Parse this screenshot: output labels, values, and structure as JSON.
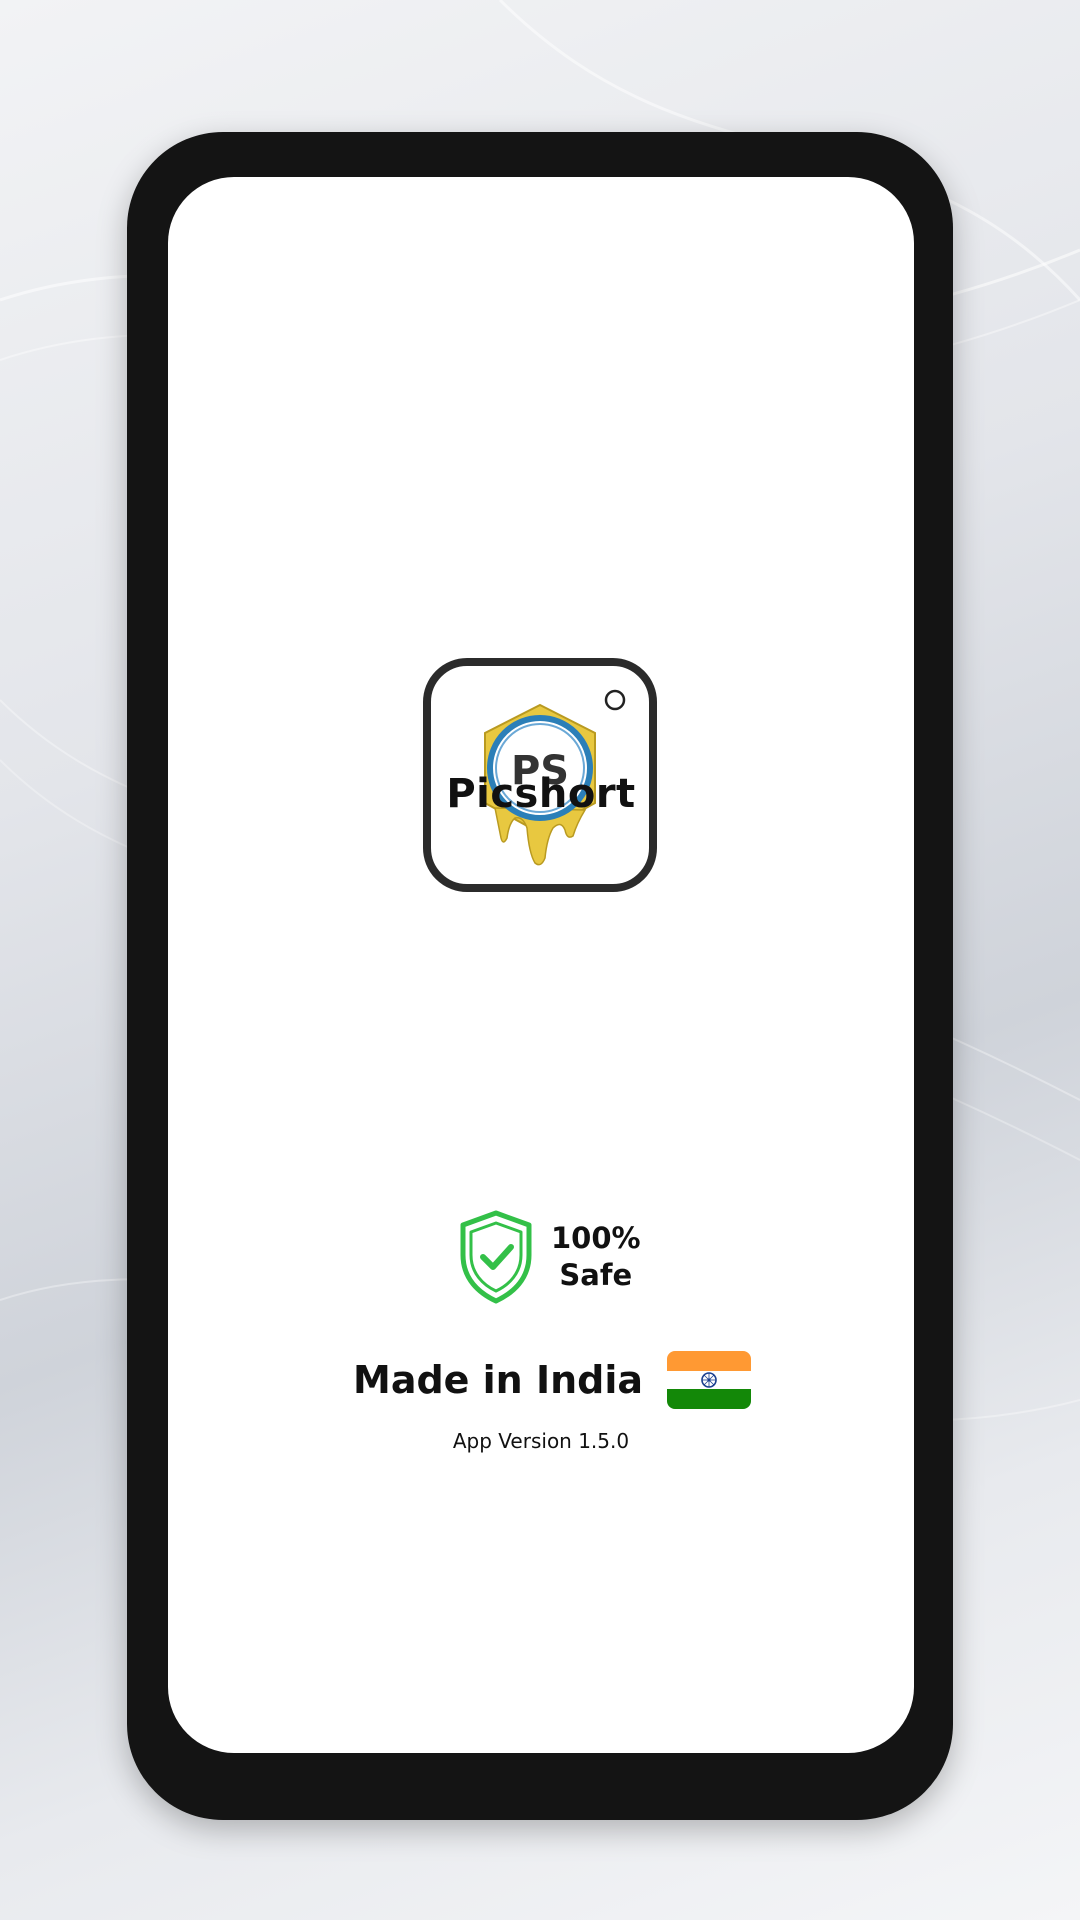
{
  "app": {
    "name": "Picshort",
    "logo_text": "PS"
  },
  "badge": {
    "percent": "100%",
    "label": "Safe"
  },
  "footer": {
    "made_in": "Made in India",
    "version": "App Version 1.5.0"
  },
  "icons": {
    "shield": "shield-check-icon",
    "flag": "india-flag-icon",
    "logo": "picshort-logo-icon"
  },
  "colors": {
    "phone_frame": "#141414",
    "screen": "#ffffff",
    "shield_green": "#33c048",
    "logo_gold": "#e8c840",
    "logo_blue": "#2b7fb8",
    "flag_saffron": "#ff9933",
    "flag_green": "#138808",
    "chakra_blue": "#1a3f8f"
  }
}
